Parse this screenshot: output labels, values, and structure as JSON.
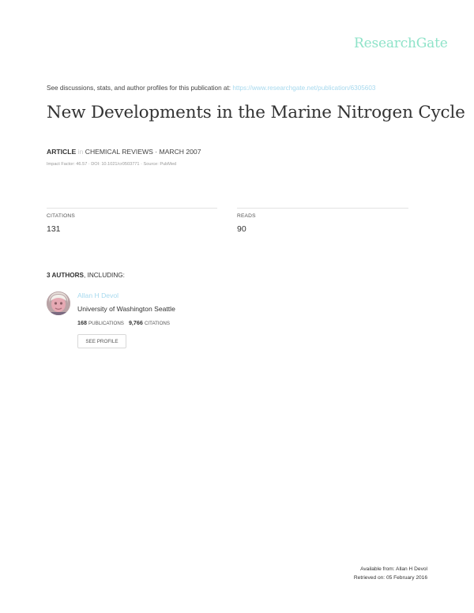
{
  "header": {
    "brand": "ResearchGate"
  },
  "intro": {
    "text": "See discussions, stats, and author profiles for this publication at:",
    "link": "https://www.researchgate.net/publication/6305603"
  },
  "title": "New Developments in the Marine Nitrogen Cycle",
  "meta": {
    "type": "ARTICLE",
    "in": "in",
    "journal_date": "CHEMICAL REVIEWS · MARCH 2007",
    "sub": "Impact Factor: 46.57 · DOI: 10.1021/cr0503771 · Source: PubMed"
  },
  "stats": {
    "citations_label": "CITATIONS",
    "citations_value": "131",
    "reads_label": "READS",
    "reads_value": "90"
  },
  "authors": {
    "heading_count": "3 AUTHORS",
    "heading_rest": ", INCLUDING:",
    "author": {
      "name": "Allan H Devol",
      "affiliation": "University of Washington Seattle",
      "publications_count": "168",
      "publications_label": "PUBLICATIONS",
      "citations_count": "9,766",
      "citations_label": "CITATIONS",
      "profile_button": "SEE PROFILE"
    }
  },
  "footer": {
    "available": "Available from: Allan H Devol",
    "retrieved": "Retrieved on: 05 February 2016"
  },
  "colors": {
    "brand": "#8fe3c9",
    "link": "#a7d9ee",
    "rule": "#e3e3e3"
  }
}
